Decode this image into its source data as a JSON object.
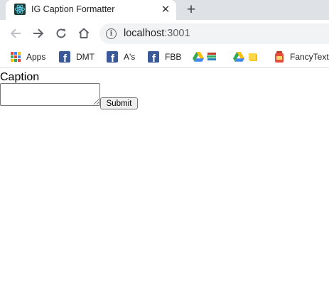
{
  "browser": {
    "tab": {
      "title": "IG Caption Formatter",
      "close_glyph": "✕"
    },
    "new_tab_glyph": "+",
    "toolbar": {
      "url_host": "localhost",
      "url_port": ":3001",
      "info_glyph": "i"
    },
    "bookmarks": [
      {
        "label": "Apps",
        "icon": "apps-grid-icon"
      },
      {
        "label": "DMT",
        "icon": "facebook-icon"
      },
      {
        "label": "A's",
        "icon": "facebook-icon"
      },
      {
        "label": "FBB",
        "icon": "facebook-icon"
      },
      {
        "label": "",
        "icon": "google-drive-books-icon"
      },
      {
        "label": "",
        "icon": "google-drive-note-icon"
      },
      {
        "label": "FancyText",
        "icon": "fancytext-icon"
      }
    ],
    "colors": {
      "tabstrip": "#dee1e6",
      "omnibox": "#f1f3f4",
      "facebook": "#3b5998"
    }
  },
  "page": {
    "caption_label": "Caption",
    "caption_value": "",
    "submit_label": "Submit"
  }
}
